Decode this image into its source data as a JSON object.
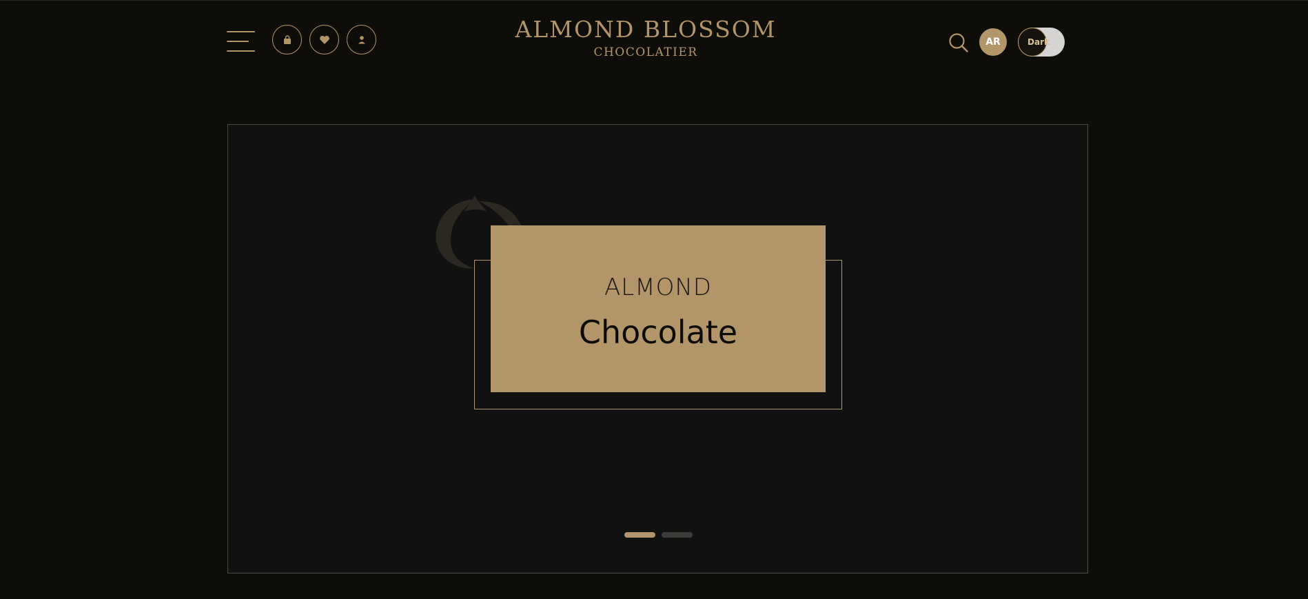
{
  "brand": {
    "name": "ALMOND BLOSSOM",
    "tagline": "CHOCOLATIER"
  },
  "header": {
    "menu_icon": "hamburger-menu-icon",
    "buttons": [
      {
        "id": "cart",
        "icon": "shopping-bag-icon"
      },
      {
        "id": "wishlist",
        "icon": "heart-icon"
      },
      {
        "id": "account",
        "icon": "user-icon"
      }
    ],
    "search_icon": "search-icon",
    "avatar_initials": "AR",
    "theme_toggle_label": "Dark"
  },
  "hero": {
    "eyebrow": "ALMOND",
    "title": "Chocolate",
    "slides": [
      {
        "active": true
      },
      {
        "active": false
      }
    ]
  },
  "colors": {
    "background": "#0f0d09",
    "panel": "#111111",
    "accent_gold": "#b3956a",
    "inactive_dot": "#3d3b38"
  }
}
